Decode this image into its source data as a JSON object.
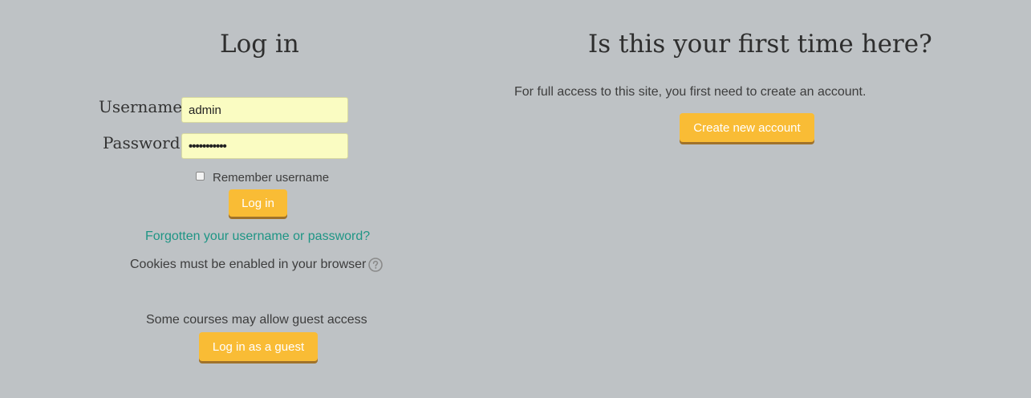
{
  "login": {
    "heading": "Log in",
    "username_label": "Username",
    "username_value": "admin",
    "password_label": "Password",
    "password_value": "•••••••••••",
    "remember_label": "Remember username",
    "remember_checked": false,
    "login_button": "Log in",
    "forgot_link": "Forgotten your username or password?",
    "cookies_notice": "Cookies must be enabled in your browser",
    "guest_notice": "Some courses may allow guest access",
    "guest_button": "Log in as a guest"
  },
  "signup": {
    "heading": "Is this your first time here?",
    "description": "For full access to this site, you first need to create an account.",
    "create_button": "Create new account"
  },
  "colors": {
    "background": "#bec2c5",
    "button": "#f9bc35",
    "link": "#1e9585",
    "input_background": "#fafcc2"
  },
  "icons": {
    "help": "question-circle-icon"
  }
}
